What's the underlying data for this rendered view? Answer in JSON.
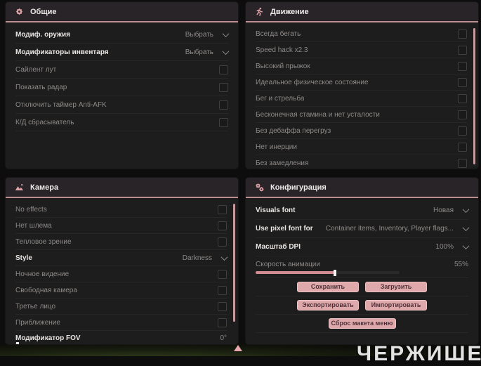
{
  "background": {
    "big_text": "ЧЕРЖИШЕ"
  },
  "colors": {
    "accent_pink": "#dfa9ac",
    "header_underline": "#bd8e90",
    "scrollbar_pink": "#c79b9d",
    "panel_bg": "#1d1d1d"
  },
  "panels": {
    "general": {
      "title": "Общие",
      "icon": "gear-icon",
      "rows": [
        {
          "label": "Модиф. оружия",
          "value": "Выбрать"
        },
        {
          "label": "Модификаторы инвентаря",
          "value": "Выбрать"
        },
        {
          "label": "Сайлент лут"
        },
        {
          "label": "Показать радар"
        },
        {
          "label": "Отключить таймер Anti-AFK"
        },
        {
          "label": "К/Д сбрасыватель"
        }
      ]
    },
    "movement": {
      "title": "Движение",
      "icon": "runner-icon",
      "rows": [
        {
          "label": "Всегда бегать"
        },
        {
          "label": "Speed hack x2.3"
        },
        {
          "label": "Высокий прыжок"
        },
        {
          "label": "Идеальное физическое состояние"
        },
        {
          "label": "Бег и стрельба"
        },
        {
          "label": "Бесконечная стамина и нет усталости"
        },
        {
          "label": "Без дебаффа перегруз"
        },
        {
          "label": "Нет инерции"
        },
        {
          "label": "Без замедления"
        }
      ]
    },
    "camera": {
      "title": "Камера",
      "icon": "mountain-icon",
      "rows": [
        {
          "label": "No effects"
        },
        {
          "label": "Нет шлема"
        },
        {
          "label": "Тепловое зрение"
        },
        {
          "label": "Style",
          "value": "Darkness"
        },
        {
          "label": "Ночное видение"
        },
        {
          "label": "Свободная камера"
        },
        {
          "label": "Третье лицо"
        },
        {
          "label": "Приближение"
        },
        {
          "label": "Модификатор FOV",
          "value": "0°"
        }
      ],
      "fov_slider_percent": 1
    },
    "config": {
      "title": "Конфигурация",
      "icon": "gears-icon",
      "rows": [
        {
          "label": "Visuals font",
          "value": "Новая"
        },
        {
          "label": "Use pixel font for",
          "value": "Container items, Inventory, Player flags..."
        },
        {
          "label": "Масштаб DPI",
          "value": "100%"
        },
        {
          "label": "Скорость анимации",
          "value": "55%"
        }
      ],
      "animation_slider_percent": 55,
      "buttons": {
        "save": "Сохранить",
        "load": "Загрузить",
        "export": "Экспортировать",
        "import": "Импортировать",
        "reset": "Сброс макета меню"
      }
    }
  }
}
